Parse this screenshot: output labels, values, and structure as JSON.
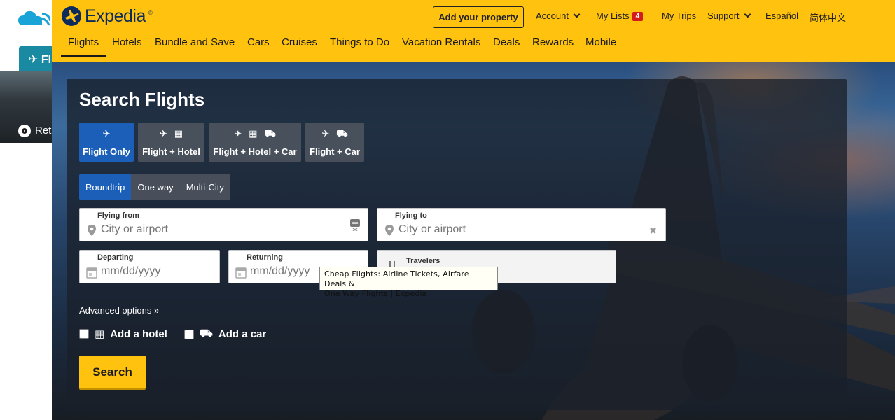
{
  "bg_window": {
    "tab_label": "Fl",
    "radio_label": "Ret"
  },
  "header": {
    "logo_text": "Expedia",
    "logo_tm": "®",
    "add_property": "Add your property",
    "account": "Account",
    "my_lists": "My Lists",
    "my_lists_count": "4",
    "my_trips": "My Trips",
    "support": "Support",
    "lang_es": "Español",
    "lang_zh": "简体中文"
  },
  "nav": {
    "items": [
      "Flights",
      "Hotels",
      "Bundle and Save",
      "Cars",
      "Cruises",
      "Things to Do",
      "Vacation Rentals",
      "Deals",
      "Rewards",
      "Mobile"
    ],
    "active": "Flights"
  },
  "search": {
    "title": "Search Flights",
    "product_tabs": [
      "Flight Only",
      "Flight + Hotel",
      "Flight + Hotel + Car",
      "Flight + Car"
    ],
    "active_product": "Flight Only",
    "trip_tabs": [
      "Roundtrip",
      "One way",
      "Multi-City"
    ],
    "active_trip": "Roundtrip",
    "flying_from": {
      "label": "Flying from",
      "placeholder": "City or airport"
    },
    "flying_to": {
      "label": "Flying to",
      "placeholder": "City or airport"
    },
    "departing": {
      "label": "Departing",
      "placeholder": "mm/dd/yyyy"
    },
    "returning": {
      "label": "Returning",
      "placeholder": "mm/dd/yyyy"
    },
    "travelers": {
      "label": "Travelers"
    },
    "advanced_options": "Advanced options »",
    "add_hotel": "Add a hotel",
    "add_car": "Add a car",
    "search_button": "Search"
  },
  "tooltip": {
    "line1": "Cheap Flights: Airline Tickets, Airfare Deals &",
    "line2": "One Way Flights | Expedia"
  },
  "colors": {
    "brand_yellow": "#ffc20e",
    "active_blue": "#1b5fb8",
    "logo_navy": "#0c2a5b",
    "badge_red": "#d41a1a",
    "bg_tab_teal": "#1a8aa3"
  }
}
